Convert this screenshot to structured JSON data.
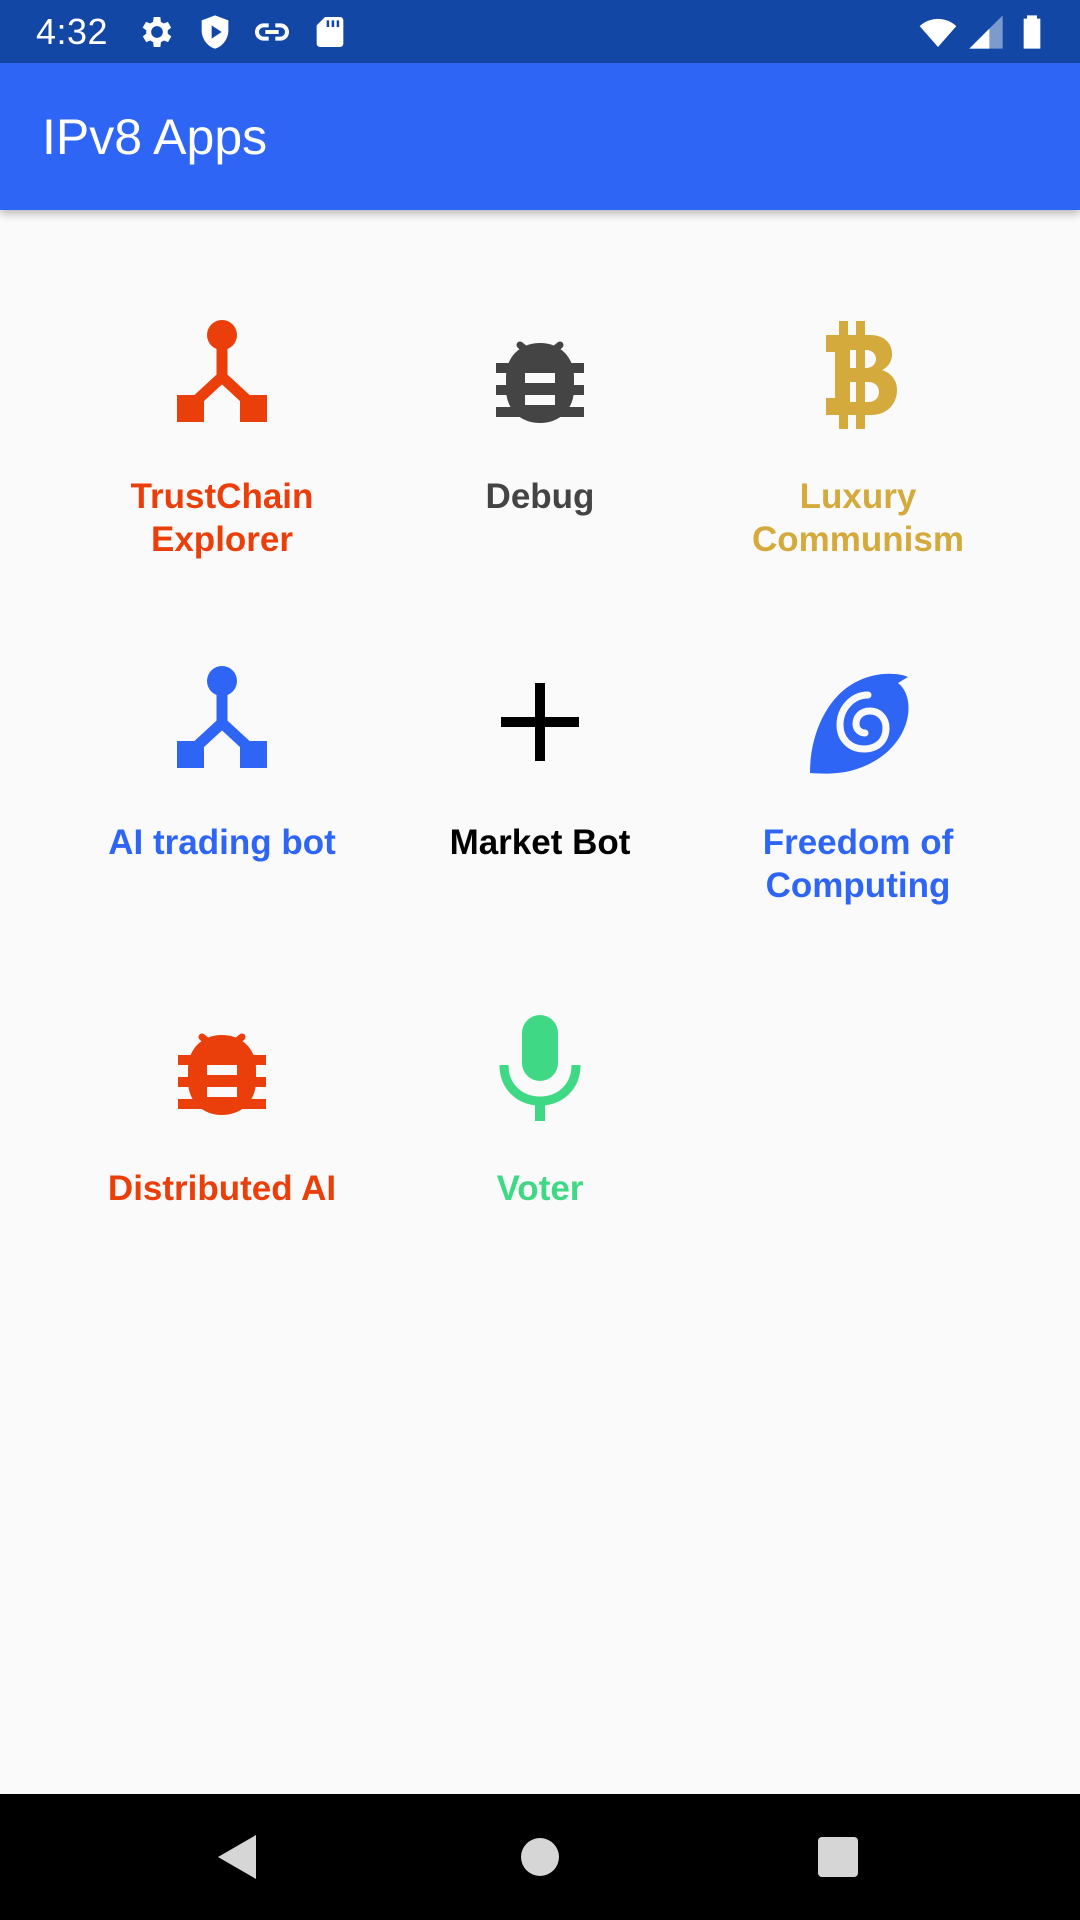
{
  "status_bar": {
    "time": "4:32",
    "left_icons": [
      "gear-icon",
      "shield-icon",
      "link-icon",
      "sd-card-icon"
    ],
    "right_icons": [
      "wifi-icon",
      "cell-signal-icon",
      "battery-icon"
    ]
  },
  "app_bar": {
    "title": "IPv8 Apps"
  },
  "apps": [
    {
      "label": "TrustChain Explorer",
      "icon": "network-icon",
      "color": "#ea3f0b"
    },
    {
      "label": "Debug",
      "icon": "bug-icon",
      "color": "#444444"
    },
    {
      "label": "Luxury Communism",
      "icon": "bitcoin-icon",
      "color": "#d4aa3c"
    },
    {
      "label": "AI trading bot",
      "icon": "network-icon",
      "color": "#2f65f5"
    },
    {
      "label": "Market Bot",
      "icon": "plus-icon",
      "color": "#000000"
    },
    {
      "label": "Freedom of Computing",
      "icon": "snail-shell-icon",
      "color": "#2f65f5"
    },
    {
      "label": "Distributed AI",
      "icon": "bug-icon",
      "color": "#ea3f0b"
    },
    {
      "label": "Voter",
      "icon": "microphone-icon",
      "color": "#3fd884"
    }
  ],
  "nav_bar": {
    "buttons": [
      "back-icon",
      "home-icon",
      "recents-icon"
    ]
  },
  "colors": {
    "status_bar": "#1347a6",
    "app_bar": "#2f65f5",
    "background": "#fafafa"
  }
}
